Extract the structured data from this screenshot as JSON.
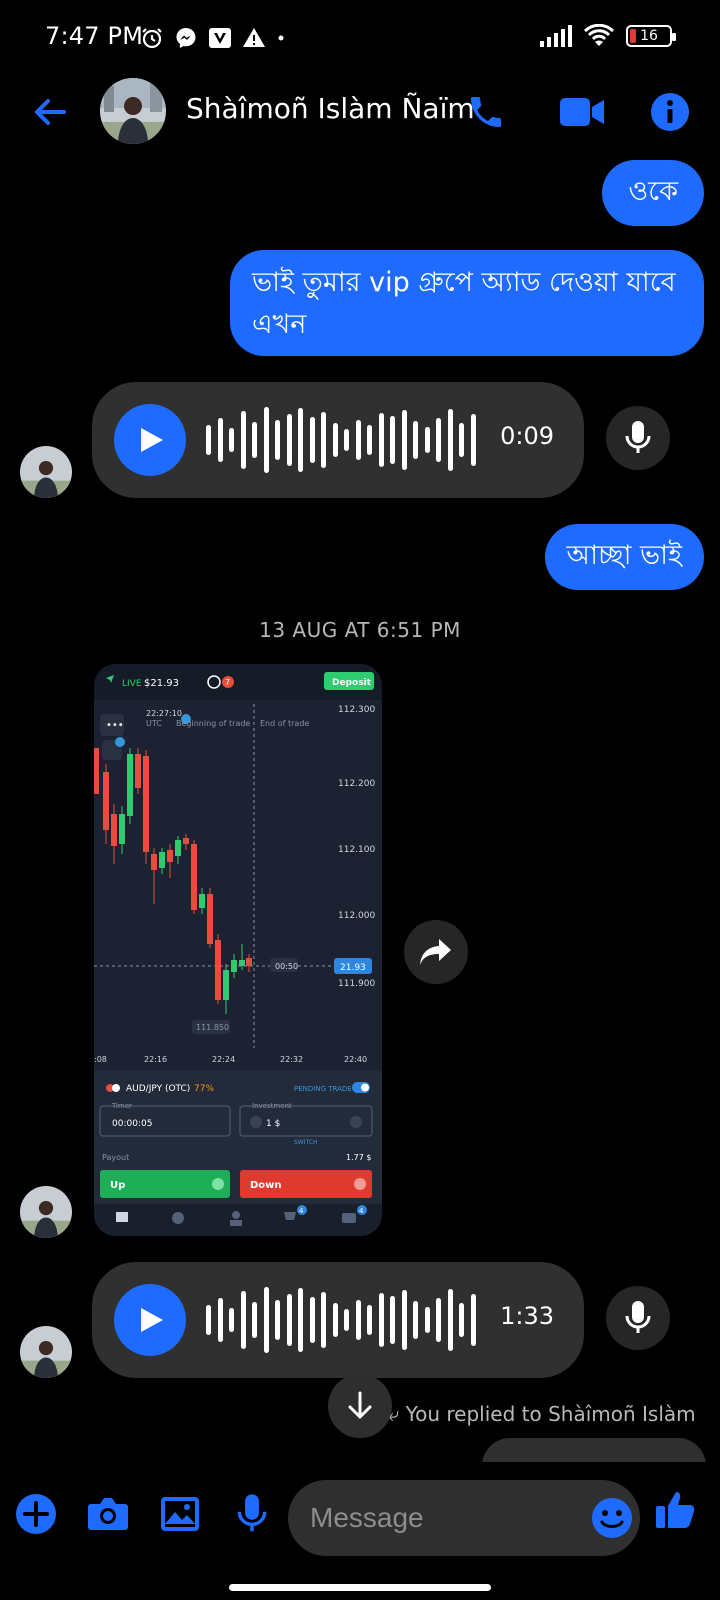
{
  "status_bar": {
    "time": "7:47 PM",
    "battery": "16",
    "icons": [
      "alarm-icon",
      "messenger-icon",
      "v-app-icon",
      "warning-icon",
      "signal-icon",
      "wifi-icon",
      "battery-icon"
    ]
  },
  "header": {
    "contact_name": "Shàîmoñ Islàm Ñaïm",
    "accent_color": "#1f6bff"
  },
  "messages": {
    "out_1": "ওকে",
    "out_2": "ভাই তুমার vip গ্রুপে অ্যাড দেওয়া যাবে এখন",
    "voice_1_duration": "0:09",
    "out_3": "আচ্ছা ভাই",
    "timestamp": "13 AUG AT 6:51 PM",
    "voice_2_duration": "1:33",
    "replied_note": "You replied to Shàîmoñ Islàm"
  },
  "attachment": {
    "live_label": "LIVE",
    "balance": "$21.93",
    "notif_count": "7",
    "deposit_label": "Deposit",
    "time_label": "22:27:10",
    "utc_label": "UTC",
    "beginning_label": "Beginning of trade",
    "end_label": "End of trade",
    "price_ticks": [
      "112.300",
      "112.200",
      "112.100",
      "112.000",
      "111.900"
    ],
    "current_price": "21.93",
    "countdown": "00:50",
    "low_label": "111.850",
    "time_ticks": [
      ":08",
      "22:16",
      "22:24",
      "22:32",
      "22:40"
    ],
    "pair": "AUD/JPY (OTC)",
    "payout_pct": "77%",
    "pending_label": "PENDING TRADE",
    "timer_label": "Timer",
    "timer_value": "00:00:05",
    "investment_label": "Investment",
    "investment_value": "1 $",
    "switch_label": "SWITCH",
    "payout_label": "Payout",
    "payout_value": "1.77 $",
    "up_label": "Up",
    "down_label": "Down",
    "tab_badges": [
      "4",
      "4"
    ]
  },
  "composer": {
    "placeholder": "Message"
  }
}
